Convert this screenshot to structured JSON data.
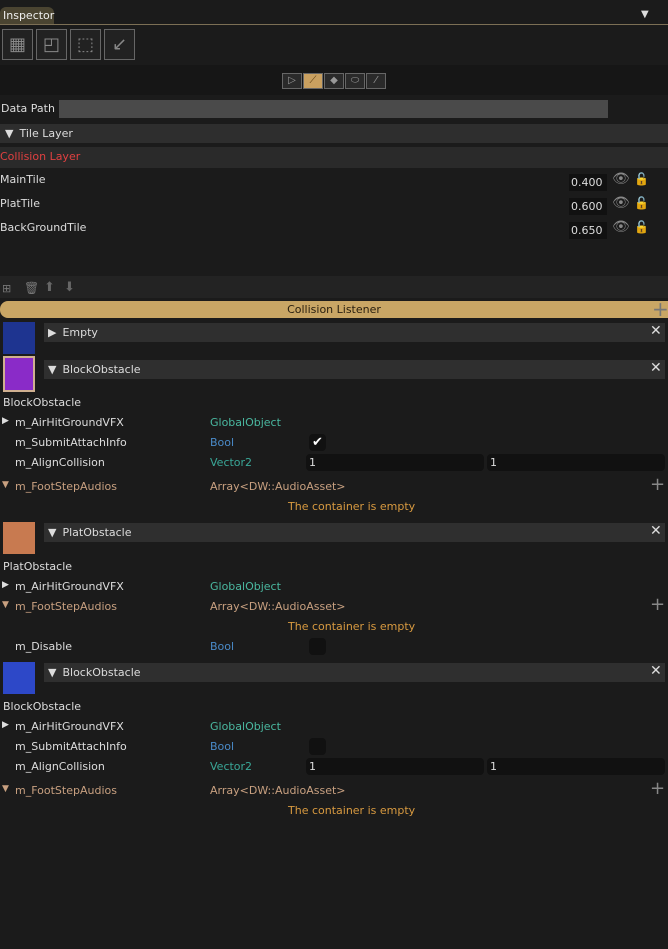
{
  "tab": {
    "title": "Inspector",
    "menu_icon": "dropdown-arrow-icon"
  },
  "toolbar": {
    "icons": [
      "new-tilemap-icon",
      "resize-icon",
      "selection-icon",
      "import-icon"
    ]
  },
  "tools": [
    {
      "name": "select-tool",
      "glyph": "▷"
    },
    {
      "name": "brush-tool",
      "glyph": "⟋",
      "active": true
    },
    {
      "name": "eraser-tool",
      "glyph": "◆"
    },
    {
      "name": "fill-tool",
      "glyph": "⬭"
    },
    {
      "name": "picker-tool",
      "glyph": "⁄"
    }
  ],
  "data_path": {
    "label": "Data Path",
    "value": ""
  },
  "tile_layer": {
    "label": "Tile Layer",
    "collision_layer": "Collision Layer",
    "layers": [
      {
        "name": "MainTile",
        "value": "0.400"
      },
      {
        "name": "PlatTile",
        "value": "0.600"
      },
      {
        "name": "BackGroundTile",
        "value": "0.650"
      }
    ]
  },
  "listener": {
    "title": "Collision Listener"
  },
  "colors": {
    "accent": "#c9a665",
    "error": "#e04040",
    "global": "#4ab8a0",
    "bool": "#4a8ac8",
    "vector": "#3aa898",
    "array": "#c8a080",
    "empty": "#d89a40"
  },
  "entries": [
    {
      "swatch": "#1e3490",
      "title": "Empty",
      "expanded": false
    },
    {
      "swatch": "#8a2bc8",
      "title": "BlockObstacle",
      "expanded": true,
      "label": "BlockObstacle",
      "fields": [
        {
          "name": "m_AirHitGroundVFX",
          "type": "GlobalObject",
          "kind": "global",
          "arrow": "▶"
        },
        {
          "name": "m_SubmitAttachInfo",
          "type": "Bool",
          "kind": "bool",
          "checked": true
        },
        {
          "name": "m_AlignCollision",
          "type": "Vector2",
          "kind": "vector",
          "x": "1",
          "y": "1"
        },
        {
          "name": "m_FootStepAudios",
          "type": "Array<DW::AudioAsset>",
          "kind": "array",
          "arrow": "▼",
          "empty": "The container is empty"
        }
      ]
    },
    {
      "swatch": "#c87a50",
      "title": "PlatObstacle",
      "expanded": true,
      "label": "PlatObstacle",
      "fields": [
        {
          "name": "m_AirHitGroundVFX",
          "type": "GlobalObject",
          "kind": "global",
          "arrow": "▶"
        },
        {
          "name": "m_FootStepAudios",
          "type": "Array<DW::AudioAsset>",
          "kind": "array",
          "arrow": "▼",
          "empty": "The container is empty"
        },
        {
          "name": "m_Disable",
          "type": "Bool",
          "kind": "bool",
          "checked": false
        }
      ]
    },
    {
      "swatch": "#2d48c8",
      "title": "BlockObstacle",
      "expanded": true,
      "label": "BlockObstacle",
      "fields": [
        {
          "name": "m_AirHitGroundVFX",
          "type": "GlobalObject",
          "kind": "global",
          "arrow": "▶"
        },
        {
          "name": "m_SubmitAttachInfo",
          "type": "Bool",
          "kind": "bool",
          "checked": false
        },
        {
          "name": "m_AlignCollision",
          "type": "Vector2",
          "kind": "vector",
          "x": "1",
          "y": "1"
        },
        {
          "name": "m_FootStepAudios",
          "type": "Array<DW::AudioAsset>",
          "kind": "array",
          "arrow": "▼",
          "empty": "The container is empty"
        }
      ]
    }
  ]
}
